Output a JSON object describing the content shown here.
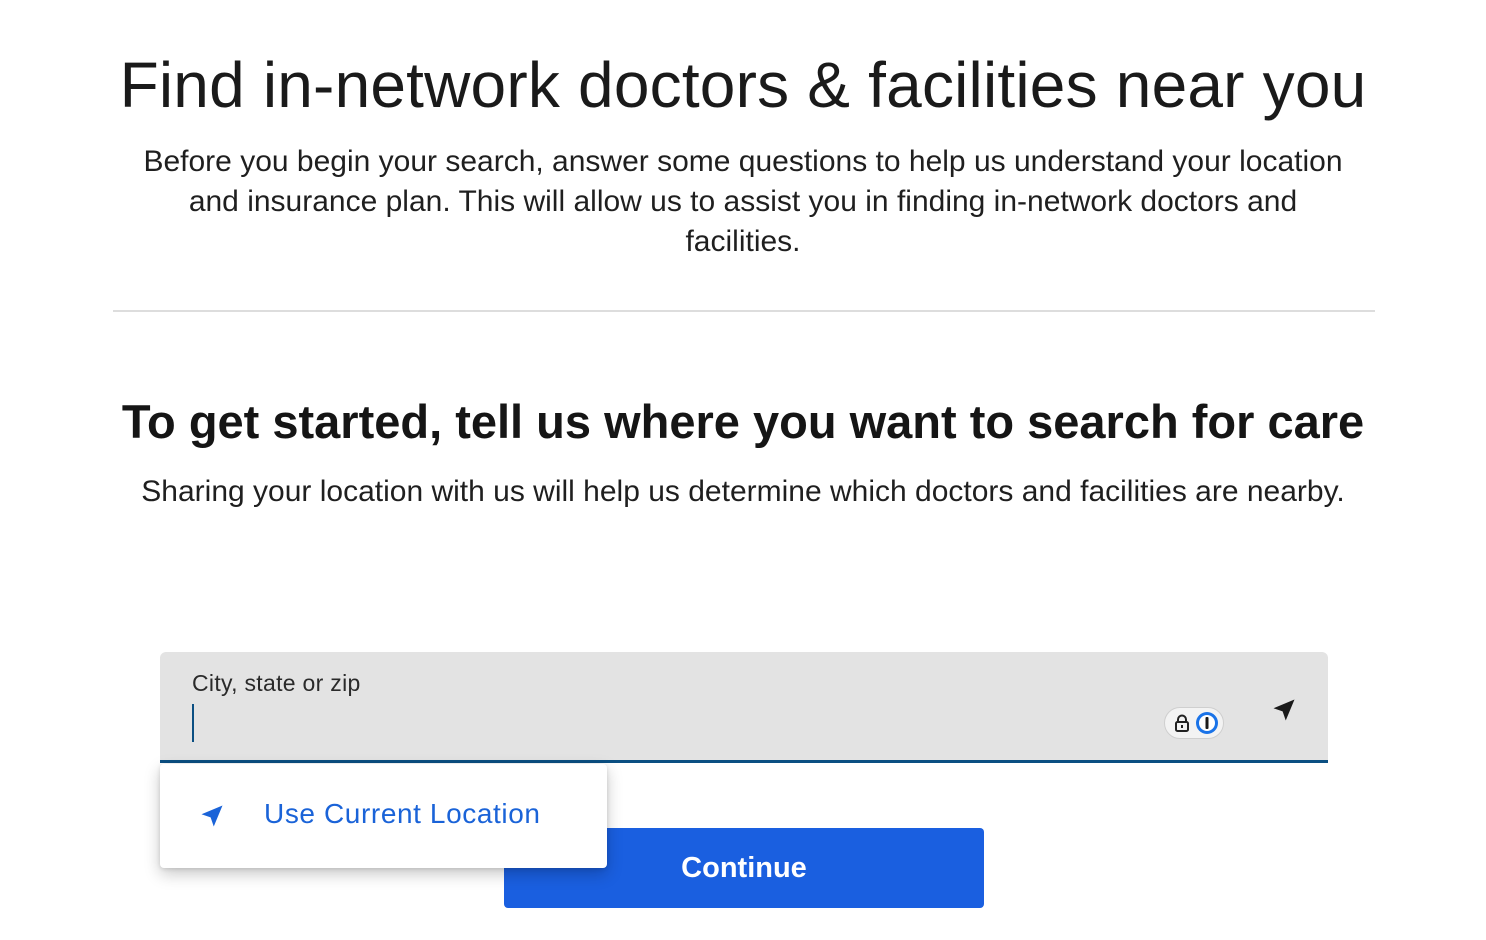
{
  "hero": {
    "title": "Find in-network doctors & facilities near you",
    "description": "Before you begin your search, answer some questions to help us understand your location and insurance plan. This will allow us to assist you in finding in-network doctors and facilities."
  },
  "location_step": {
    "title": "To get started, tell us where you want to search for care",
    "description": "Sharing your location with us will help us determine which doctors and facilities are nearby.",
    "field": {
      "label": "City, state or zip",
      "value": "",
      "geolocate_icon": "location-arrow-icon",
      "password_manager_icon": "password-manager-icon"
    },
    "suggestions": [
      {
        "label": "Use Current Location",
        "icon": "location-arrow-icon"
      }
    ],
    "continue_label": "Continue"
  },
  "colors": {
    "primary_button": "#1a5fe0",
    "link": "#1a63d8",
    "field_background": "#e3e3e3",
    "field_underline": "#0b4f82",
    "divider": "#dddddd"
  }
}
